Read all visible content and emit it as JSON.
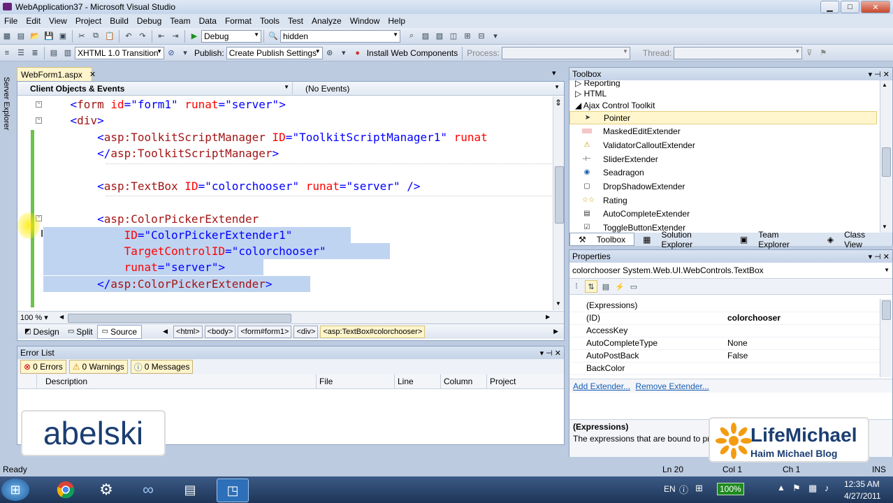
{
  "window": {
    "title": "WebApplication37 - Microsoft Visual Studio"
  },
  "menu": [
    "File",
    "Edit",
    "View",
    "Project",
    "Build",
    "Debug",
    "Team",
    "Data",
    "Format",
    "Tools",
    "Test",
    "Analyze",
    "Window",
    "Help"
  ],
  "toolbar1": {
    "config": "Debug",
    "find": "hidden"
  },
  "toolbar2": {
    "doctype": "XHTML 1.0 Transition",
    "publish_label": "Publish:",
    "publish_value": "Create Publish Settings",
    "install": "Install Web Components",
    "process_label": "Process:",
    "thread_label": "Thread:"
  },
  "left_strip": {
    "server_explorer": "Server Explorer"
  },
  "doc_tab": {
    "name": "WebForm1.aspx",
    "close": "✕"
  },
  "navbar": {
    "objects": "Client Objects & Events",
    "events": "(No Events)"
  },
  "code": {
    "l1": {
      "indent": "    ",
      "a": "<",
      "b": "form",
      "c": " id",
      "d": "=",
      "e": "\"form1\"",
      "f": " runat",
      "g": "=",
      "h": "\"server\"",
      "i": ">"
    },
    "l2": {
      "indent": "    ",
      "a": "<",
      "b": "div",
      "c": ">"
    },
    "l3": {
      "indent": "        ",
      "a": "<",
      "b": "asp:ToolkitScriptManager",
      "c": " ID",
      "d": "=",
      "e": "\"ToolkitScriptManager1\"",
      "f": " runat"
    },
    "l4": {
      "indent": "        ",
      "a": "</",
      "b": "asp:ToolkitScriptManager",
      "c": ">"
    },
    "l5": {
      "indent": "        ",
      "a": "<",
      "b": "asp:TextBox",
      "c": " ID",
      "d": "=",
      "e": "\"colorchooser\"",
      "f": " runat",
      "g": "=",
      "h": "\"server\"",
      "i": " />"
    },
    "l6": {
      "indent": "        ",
      "a": "<",
      "b": "asp:ColorPickerExtender"
    },
    "l7": {
      "indent": "            ",
      "c": "ID",
      "d": "=",
      "e": "\"ColorPickerExtender1\""
    },
    "l8": {
      "indent": "            ",
      "c": "TargetControlID",
      "d": "=",
      "e": "\"colorchooser\""
    },
    "l9": {
      "indent": "            ",
      "c": "runat",
      "d": "=",
      "e": "\"server\"",
      "f": ">"
    },
    "l10": {
      "indent": "        ",
      "a": "</",
      "b": "asp:ColorPickerExtender",
      "c": ">"
    }
  },
  "zoom": "100 %",
  "views": {
    "design": "Design",
    "split": "Split",
    "source": "Source"
  },
  "breadcrumbs": [
    "<html>",
    "<body>",
    "<form#form1>",
    "<div>",
    "<asp:TextBox#colorchooser>"
  ],
  "error_list": {
    "title": "Error List",
    "errors": "0 Errors",
    "warnings": "0 Warnings",
    "messages": "0 Messages",
    "columns": [
      "Description",
      "File",
      "Line",
      "Column",
      "Project"
    ]
  },
  "toolbox": {
    "title": "Toolbox",
    "groups": {
      "reporting": "Reporting",
      "html": "HTML",
      "ajax": "Ajax Control Toolkit"
    },
    "items": [
      "Pointer",
      "MaskedEditExtender",
      "ValidatorCalloutExtender",
      "SliderExtender",
      "Seadragon",
      "DropShadowExtender",
      "Rating",
      "AutoCompleteExtender",
      "ToggleButtonExtender"
    ]
  },
  "panel_tabs": [
    "Toolbox",
    "Solution Explorer",
    "Team Explorer",
    "Class View"
  ],
  "properties": {
    "title": "Properties",
    "object_name": "colorchooser",
    "object_type": "System.Web.UI.WebControls.TextBox",
    "rows": [
      {
        "name": "(Expressions)",
        "value": ""
      },
      {
        "name": "(ID)",
        "value": "colorchooser"
      },
      {
        "name": "AccessKey",
        "value": ""
      },
      {
        "name": "AutoCompleteType",
        "value": "None"
      },
      {
        "name": "AutoPostBack",
        "value": "False"
      },
      {
        "name": "BackColor",
        "value": ""
      }
    ],
    "add_extender": "Add Extender...",
    "remove_extender": "Remove Extender...",
    "desc_title": "(Expressions)",
    "desc_text": "The expressions that are bound to prop"
  },
  "status": {
    "ready": "Ready",
    "ln": "Ln 20",
    "col": "Col 1",
    "ch": "Ch 1",
    "ins": "INS"
  },
  "taskbar": {
    "lang": "EN",
    "zoom": "100%",
    "time": "12:35 AM",
    "date": "4/27/2011"
  },
  "logos": {
    "abelski": "abelski",
    "lm_name": "LifeMichael",
    "lm_sub": "Haim Michael Blog"
  }
}
